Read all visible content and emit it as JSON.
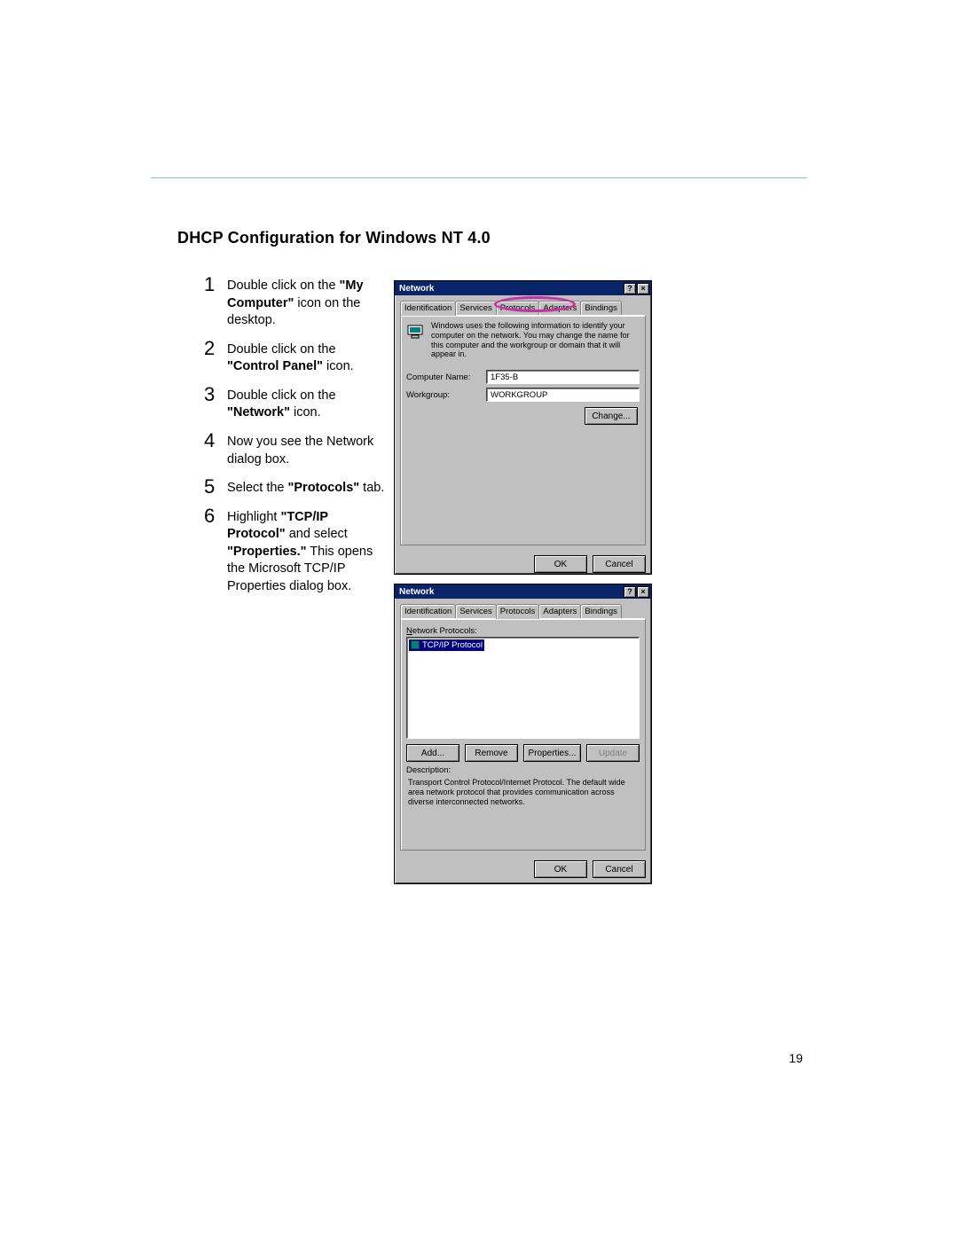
{
  "page": {
    "heading": "DHCP Configuration for Windows NT 4.0",
    "page_number": "19"
  },
  "steps": [
    {
      "num": "1",
      "pre": "Double click on the ",
      "bold": "\"My Computer\"",
      "post": " icon on the desktop."
    },
    {
      "num": "2",
      "pre": "Double click on the ",
      "bold": "\"Control Panel\"",
      "post": " icon."
    },
    {
      "num": "3",
      "pre": "Double click on the ",
      "bold": "\"Network\"",
      "post": " icon."
    },
    {
      "num": "4",
      "pre": "Now you see the Network dialog box.",
      "bold": "",
      "post": ""
    },
    {
      "num": "5",
      "pre": "Select the ",
      "bold": "\"Protocols\"",
      "post": " tab."
    },
    {
      "num": "6",
      "pre": "Highlight ",
      "bold": "\"TCP/IP Protocol\"",
      "post": " and select ",
      "bold2": "\"Properties.\"",
      "post2": " This opens the Microsoft TCP/IP Properties dialog box."
    }
  ],
  "dlg1": {
    "title": "Network",
    "tabs": [
      "Identification",
      "Services",
      "Protocols",
      "Adapters",
      "Bindings"
    ],
    "active_tab": 0,
    "desc": "Windows uses the following information to identify your computer on the network. You may change the name for this computer and the workgroup or domain that it will appear in.",
    "computer_name_label": "Computer Name:",
    "computer_name_value": "1F35-B",
    "workgroup_label": "Workgroup:",
    "workgroup_value": "WORKGROUP",
    "change_btn": "Change...",
    "ok_btn": "OK",
    "cancel_btn": "Cancel",
    "help_btn": "?",
    "close_btn": "×"
  },
  "dlg2": {
    "title": "Network",
    "tabs": [
      "Identification",
      "Services",
      "Protocols",
      "Adapters",
      "Bindings"
    ],
    "active_tab": 2,
    "list_label": "Network Protocols:",
    "selected_item": "TCP/IP Protocol",
    "add_btn": "Add...",
    "remove_btn": "Remove",
    "properties_btn": "Properties...",
    "update_btn": "Update",
    "desc_label": "Description:",
    "desc_text": "Transport Control Protocol/Internet Protocol. The default wide area network protocol that provides communication across diverse interconnected networks.",
    "ok_btn": "OK",
    "cancel_btn": "Cancel",
    "help_btn": "?",
    "close_btn": "×"
  }
}
